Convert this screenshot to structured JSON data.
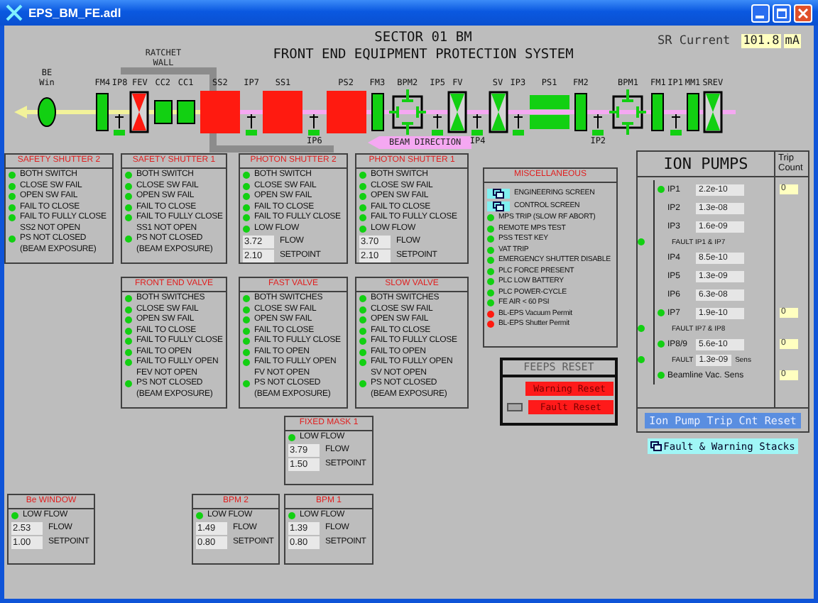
{
  "window": {
    "title": "EPS_BM_FE.adl"
  },
  "header": {
    "lines": [
      "SECTOR 01 BM",
      "FRONT END EQUIPMENT PROTECTION SYSTEM"
    ],
    "sr_current": {
      "label": "SR Current",
      "value": "101.8",
      "unit": "mA"
    }
  },
  "beamline": {
    "wall_label": "RATCHET WALL",
    "direction_label": "BEAM DIRECTION",
    "components": [
      {
        "label": "BE Win",
        "kind": "window",
        "ok": true
      },
      {
        "label": "FM4",
        "kind": "mask",
        "ok": true
      },
      {
        "label": "IP8",
        "kind": "pump",
        "ok": true
      },
      {
        "label": "FEV",
        "kind": "valve",
        "ok": false
      },
      {
        "label": "CC2",
        "kind": "collimator",
        "ok": true
      },
      {
        "label": "CC1",
        "kind": "collimator",
        "ok": true
      },
      {
        "label": "SS2",
        "kind": "shutter",
        "ok": false
      },
      {
        "label": "IP7",
        "kind": "pump",
        "ok": true
      },
      {
        "label": "SS1",
        "kind": "shutter",
        "ok": false
      },
      {
        "label": "IP6",
        "kind": "pumpbelow",
        "ok": true
      },
      {
        "label": "PS2",
        "kind": "shutter",
        "ok": false
      },
      {
        "label": "FM3",
        "kind": "mask",
        "ok": true
      },
      {
        "label": "BPM2",
        "kind": "bpm",
        "ok": true
      },
      {
        "label": "IP5",
        "kind": "pump",
        "ok": true
      },
      {
        "label": "FV",
        "kind": "valve",
        "ok": true
      },
      {
        "label": "IP4",
        "kind": "pumpbelow",
        "ok": true
      },
      {
        "label": "SV",
        "kind": "valve",
        "ok": true
      },
      {
        "label": "IP3",
        "kind": "pump",
        "ok": true
      },
      {
        "label": "PS1",
        "kind": "shutter",
        "ok": true
      },
      {
        "label": "FM2",
        "kind": "mask",
        "ok": true
      },
      {
        "label": "IP2",
        "kind": "pumpbelow",
        "ok": true
      },
      {
        "label": "BPM1",
        "kind": "bpm",
        "ok": true
      },
      {
        "label": "FM1",
        "kind": "mask",
        "ok": true
      },
      {
        "label": "IP1",
        "kind": "pump",
        "ok": true
      },
      {
        "label": "MM1",
        "kind": "mask",
        "ok": true
      },
      {
        "label": "SREV",
        "kind": "valve",
        "ok": true
      }
    ]
  },
  "panels": [
    {
      "title": "SAFETY SHUTTER 2",
      "rows": [
        {
          "kind": "indicator",
          "label": "BOTH SWITCH",
          "alarm": false
        },
        {
          "kind": "indicator",
          "label": "CLOSE SW FAIL",
          "alarm": false
        },
        {
          "kind": "indicator",
          "label": "OPEN SW FAIL",
          "alarm": false
        },
        {
          "kind": "indicator",
          "label": "FAIL TO CLOSE",
          "alarm": false
        },
        {
          "kind": "indicator",
          "label": "FAIL TO FULLY CLOSE",
          "alarm": false
        },
        {
          "kind": "indicator",
          "label": "SS2 NOT OPEN\nPS NOT CLOSED\n(BEAM EXPOSURE)",
          "alarm": false
        }
      ]
    },
    {
      "title": "SAFETY SHUTTER 1",
      "rows": [
        {
          "kind": "indicator",
          "label": "BOTH SWITCH",
          "alarm": false
        },
        {
          "kind": "indicator",
          "label": "CLOSE SW FAIL",
          "alarm": false
        },
        {
          "kind": "indicator",
          "label": "OPEN SW FAIL",
          "alarm": false
        },
        {
          "kind": "indicator",
          "label": "FAIL TO CLOSE",
          "alarm": false
        },
        {
          "kind": "indicator",
          "label": "FAIL TO FULLY CLOSE",
          "alarm": false
        },
        {
          "kind": "indicator",
          "label": "SS1 NOT OPEN\nPS NOT CLOSED\n(BEAM EXPOSURE)",
          "alarm": false
        }
      ]
    },
    {
      "title": "PHOTON SHUTTER 2",
      "rows": [
        {
          "kind": "indicator",
          "label": "BOTH SWITCH",
          "alarm": false
        },
        {
          "kind": "indicator",
          "label": "CLOSE SW FAIL",
          "alarm": false
        },
        {
          "kind": "indicator",
          "label": "OPEN SW FAIL",
          "alarm": false
        },
        {
          "kind": "indicator",
          "label": "FAIL TO CLOSE",
          "alarm": false
        },
        {
          "kind": "indicator",
          "label": "FAIL TO FULLY CLOSE",
          "alarm": false
        },
        {
          "kind": "indicator",
          "label": "LOW FLOW",
          "alarm": false
        },
        {
          "kind": "reading",
          "value": "3.72",
          "name": "FLOW"
        },
        {
          "kind": "reading",
          "value": "2.10",
          "name": "SETPOINT"
        }
      ]
    },
    {
      "title": "PHOTON SHUTTER 1",
      "rows": [
        {
          "kind": "indicator",
          "label": "BOTH SWITCH",
          "alarm": false
        },
        {
          "kind": "indicator",
          "label": "CLOSE SW FAIL",
          "alarm": false
        },
        {
          "kind": "indicator",
          "label": "OPEN SW FAIL",
          "alarm": false
        },
        {
          "kind": "indicator",
          "label": "FAIL TO CLOSE",
          "alarm": false
        },
        {
          "kind": "indicator",
          "label": "FAIL TO FULLY CLOSE",
          "alarm": false
        },
        {
          "kind": "indicator",
          "label": "LOW FLOW",
          "alarm": false
        },
        {
          "kind": "reading",
          "value": "3.70",
          "name": "FLOW"
        },
        {
          "kind": "reading",
          "value": "2.10",
          "name": "SETPOINT"
        }
      ]
    },
    {
      "title": "MISCELLANEOUS",
      "rows": [
        {
          "kind": "button",
          "label": "ENGINEERING SCREEN"
        },
        {
          "kind": "button",
          "label": "CONTROL SCREEN"
        },
        {
          "kind": "indicator",
          "label": "MPS TRIP (SLOW RF ABORT)",
          "alarm": false
        },
        {
          "kind": "indicator",
          "label": "REMOTE MPS TEST",
          "alarm": false
        },
        {
          "kind": "indicator",
          "label": "PSS TEST KEY",
          "alarm": false
        },
        {
          "kind": "indicator",
          "label": "VAT TRIP",
          "alarm": false
        },
        {
          "kind": "indicator",
          "label": "EMERGENCY SHUTTER DISABLE",
          "alarm": false
        },
        {
          "kind": "indicator",
          "label": "PLC FORCE PRESENT",
          "alarm": false
        },
        {
          "kind": "indicator",
          "label": "PLC LOW BATTERY",
          "alarm": false
        },
        {
          "kind": "indicator",
          "label": "PLC POWER-CYCLE",
          "alarm": false
        },
        {
          "kind": "indicator",
          "label": "FE AIR < 60 PSI",
          "alarm": false
        },
        {
          "kind": "indicator",
          "label": "BL-EPS Vacuum Permit",
          "alarm": true
        },
        {
          "kind": "indicator",
          "label": "BL-EPS Shutter Permit",
          "alarm": true
        }
      ]
    },
    {
      "title": "FRONT END VALVE",
      "rows": [
        {
          "kind": "indicator",
          "label": "BOTH SWITCHES",
          "alarm": false
        },
        {
          "kind": "indicator",
          "label": "CLOSE SW FAIL",
          "alarm": false
        },
        {
          "kind": "indicator",
          "label": "OPEN SW FAIL",
          "alarm": false
        },
        {
          "kind": "indicator",
          "label": "FAIL TO CLOSE",
          "alarm": false
        },
        {
          "kind": "indicator",
          "label": "FAIL TO FULLY CLOSE",
          "alarm": false
        },
        {
          "kind": "indicator",
          "label": "FAIL TO OPEN",
          "alarm": false
        },
        {
          "kind": "indicator",
          "label": "FAIL TO FULLY OPEN",
          "alarm": false
        },
        {
          "kind": "indicator",
          "label": "FEV NOT OPEN\nPS NOT CLOSED\n(BEAM EXPOSURE)",
          "alarm": false
        }
      ]
    },
    {
      "title": "FAST VALVE",
      "rows": [
        {
          "kind": "indicator",
          "label": "BOTH SWITCHES",
          "alarm": false
        },
        {
          "kind": "indicator",
          "label": "CLOSE SW FAIL",
          "alarm": false
        },
        {
          "kind": "indicator",
          "label": "OPEN SW FAIL",
          "alarm": false
        },
        {
          "kind": "indicator",
          "label": "FAIL TO CLOSE",
          "alarm": false
        },
        {
          "kind": "indicator",
          "label": "FAIL TO FULLY CLOSE",
          "alarm": false
        },
        {
          "kind": "indicator",
          "label": "FAIL TO OPEN",
          "alarm": false
        },
        {
          "kind": "indicator",
          "label": "FAIL TO FULLY OPEN",
          "alarm": false
        },
        {
          "kind": "indicator",
          "label": "FV NOT OPEN\nPS NOT CLOSED\n(BEAM EXPOSURE)",
          "alarm": false
        }
      ]
    },
    {
      "title": "SLOW VALVE",
      "rows": [
        {
          "kind": "indicator",
          "label": "BOTH SWITCHES",
          "alarm": false
        },
        {
          "kind": "indicator",
          "label": "CLOSE SW FAIL",
          "alarm": false
        },
        {
          "kind": "indicator",
          "label": "OPEN SW FAIL",
          "alarm": false
        },
        {
          "kind": "indicator",
          "label": "FAIL TO CLOSE",
          "alarm": false
        },
        {
          "kind": "indicator",
          "label": "FAIL TO FULLY CLOSE",
          "alarm": false
        },
        {
          "kind": "indicator",
          "label": "FAIL TO OPEN",
          "alarm": false
        },
        {
          "kind": "indicator",
          "label": "FAIL TO FULLY OPEN",
          "alarm": false
        },
        {
          "kind": "indicator",
          "label": "SV NOT OPEN\nPS NOT CLOSED\n(BEAM EXPOSURE)",
          "alarm": false
        }
      ]
    },
    {
      "title": "FIXED MASK 1",
      "rows": [
        {
          "kind": "indicator",
          "label": "LOW FLOW",
          "alarm": false
        },
        {
          "kind": "reading",
          "value": "3.79",
          "name": "FLOW"
        },
        {
          "kind": "reading",
          "value": "1.50",
          "name": "SETPOINT"
        }
      ]
    },
    {
      "title": "Be WINDOW",
      "rows": [
        {
          "kind": "indicator",
          "label": "LOW FLOW",
          "alarm": false
        },
        {
          "kind": "reading",
          "value": "2.53",
          "name": "FLOW"
        },
        {
          "kind": "reading",
          "value": "1.00",
          "name": "SETPOINT"
        }
      ]
    },
    {
      "title": "BPM 2",
      "rows": [
        {
          "kind": "indicator",
          "label": "LOW FLOW",
          "alarm": false
        },
        {
          "kind": "reading",
          "value": "1.49",
          "name": "FLOW"
        },
        {
          "kind": "reading",
          "value": "0.80",
          "name": "SETPOINT"
        }
      ]
    },
    {
      "title": "BPM 1",
      "rows": [
        {
          "kind": "indicator",
          "label": "LOW FLOW",
          "alarm": false
        },
        {
          "kind": "reading",
          "value": "1.39",
          "name": "FLOW"
        },
        {
          "kind": "reading",
          "value": "0.80",
          "name": "SETPOINT"
        }
      ]
    }
  ],
  "ion_pumps": {
    "title": "ION PUMPS",
    "trip_header": "Trip Count",
    "rows": [
      {
        "kind": "pump",
        "label": "IP1",
        "value": "2.2e-10",
        "alarm": false,
        "trip_count": "0"
      },
      {
        "kind": "pump",
        "label": "IP2",
        "value": "1.3e-08"
      },
      {
        "kind": "pump",
        "label": "IP3",
        "value": "1.6e-09"
      },
      {
        "kind": "fault",
        "label": "FAULT IP1 & IP7",
        "alarm": false
      },
      {
        "kind": "pump",
        "label": "IP4",
        "value": "8.5e-10"
      },
      {
        "kind": "pump",
        "label": "IP5",
        "value": "1.3e-09"
      },
      {
        "kind": "pump",
        "label": "IP6",
        "value": "6.3e-08"
      },
      {
        "kind": "pump",
        "label": "IP7",
        "value": "1.9e-10",
        "alarm": false,
        "trip_count": "0"
      },
      {
        "kind": "fault",
        "label": "FAULT IP7 & IP8",
        "alarm": false
      },
      {
        "kind": "pump",
        "label": "IP8/9",
        "value": "5.6e-10",
        "alarm": false,
        "trip_count": "0"
      },
      {
        "kind": "fault",
        "label": "FAULT",
        "value": "1.3e-09",
        "suffix": "Sens",
        "alarm": false
      },
      {
        "kind": "pump",
        "label": "Beamline Vac. Sens",
        "alarm": false,
        "trip_count": "0"
      }
    ],
    "reset_button": "Ion Pump Trip Cnt Reset"
  },
  "feeps_reset": {
    "title": "FEEPS RESET",
    "warning_button": "Warning Reset",
    "fault_button": "Fault Reset",
    "fault_lit": false
  },
  "stacks_button": "Fault & Warning Stacks"
}
